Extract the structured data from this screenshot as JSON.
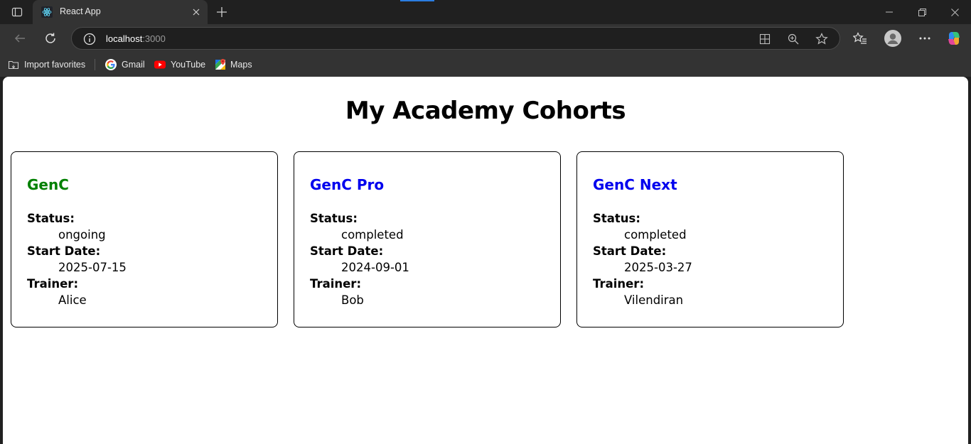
{
  "browser": {
    "tab": {
      "title": "React App",
      "favicon": "react-icon"
    },
    "address": {
      "host": "localhost",
      "port": ":3000"
    },
    "bookmarks": [
      {
        "label": "Import favorites",
        "icon": "import-icon"
      },
      {
        "label": "Gmail",
        "icon": "google-icon"
      },
      {
        "label": "YouTube",
        "icon": "youtube-icon"
      },
      {
        "label": "Maps",
        "icon": "maps-icon"
      }
    ]
  },
  "page": {
    "title": "My Academy Cohorts",
    "labels": {
      "status": "Status:",
      "start_date": "Start Date:",
      "trainer": "Trainer:"
    },
    "cohorts": [
      {
        "name": "GenC",
        "status": "ongoing",
        "start_date": "2025-07-15",
        "trainer": "Alice",
        "name_color": "#008000"
      },
      {
        "name": "GenC Pro",
        "status": "completed",
        "start_date": "2024-09-01",
        "trainer": "Bob",
        "name_color": "#0000ee"
      },
      {
        "name": "GenC Next",
        "status": "completed",
        "start_date": "2025-03-27",
        "trainer": "Vilendiran",
        "name_color": "#0000ee"
      }
    ]
  }
}
